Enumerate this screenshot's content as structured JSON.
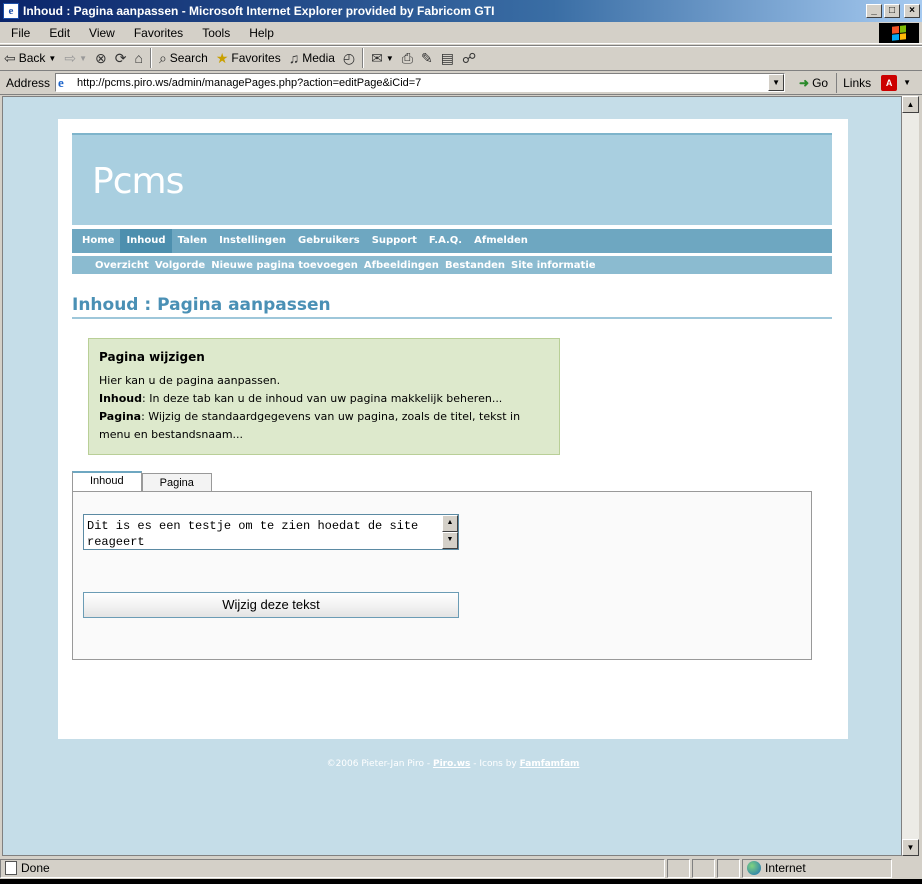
{
  "window": {
    "title": "Inhoud : Pagina aanpassen - Microsoft Internet Explorer provided by Fabricom GTI",
    "buttons": {
      "minimize": "_",
      "maximize": "□",
      "close": "×"
    }
  },
  "menubar": {
    "items": [
      "File",
      "Edit",
      "View",
      "Favorites",
      "Tools",
      "Help"
    ]
  },
  "toolbar": {
    "back": "Back",
    "search": "Search",
    "favorites": "Favorites",
    "media": "Media"
  },
  "address": {
    "label": "Address",
    "url": "http://pcms.piro.ws/admin/managePages.php?action=editPage&iCid=7",
    "go": "Go",
    "links": "Links"
  },
  "site": {
    "logo": "Pcms",
    "nav": [
      "Home",
      "Inhoud",
      "Talen",
      "Instellingen",
      "Gebruikers",
      "Support",
      "F.A.Q.",
      "Afmelden"
    ],
    "active_nav": "Inhoud",
    "subnav": [
      "Overzicht",
      "Volgorde",
      "Nieuwe pagina toevoegen",
      "Afbeeldingen",
      "Bestanden",
      "Site informatie"
    ],
    "heading": "Inhoud : Pagina aanpassen"
  },
  "infobox": {
    "title": "Pagina wijzigen",
    "line1": "Hier kan u de pagina aanpassen.",
    "line2_bold": "Inhoud",
    "line2_rest": ": In deze tab kan u de inhoud van uw pagina makkelijk beheren...",
    "line3_bold": "Pagina",
    "line3_rest": ": Wijzig de standaardgegevens van uw pagina, zoals de titel, tekst in menu en bestandsnaam..."
  },
  "tabs": [
    {
      "label": "Inhoud",
      "active": true
    },
    {
      "label": "Pagina",
      "active": false
    }
  ],
  "editor": {
    "text": "Dit is es een testje om te zien hoedat de site reageert",
    "submit": "Wijzig deze tekst"
  },
  "footer": {
    "copyright": "©2006 Pieter-Jan Piro - ",
    "link1": "Piro.ws",
    "middle": " - Icons by ",
    "link2": "Famfamfam"
  },
  "status": {
    "text": "Done",
    "zone": "Internet"
  },
  "colors": {
    "accent": "#4a90b5",
    "header": "#a9cfe0",
    "nav": "#6ea7c1",
    "infobox": "#dde9cc"
  }
}
